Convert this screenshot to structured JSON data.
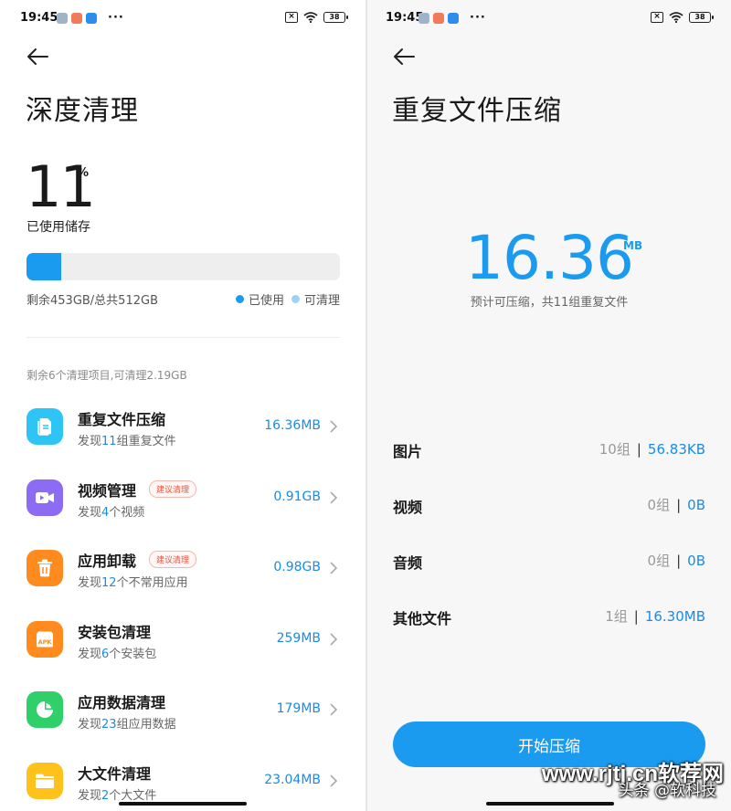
{
  "status_bar": {
    "time": "19:45",
    "battery": "38",
    "more": "···"
  },
  "left": {
    "title": "深度清理",
    "usage": {
      "percent": "11",
      "unit": "%",
      "label": "已使用储存",
      "fraction": 0.11
    },
    "storage_text": "剩余453GB/总共512GB",
    "legend": {
      "used": "已使用",
      "cleanable": "可清理"
    },
    "summary": "剩余6个清理项目,可清理2.19GB",
    "items": [
      {
        "title": "重复文件压缩",
        "tag": "",
        "desc_pre": "发现",
        "desc_num": "11",
        "desc_post": "组重复文件",
        "size": "16.36MB",
        "icon": "duplicate-file-icon",
        "color": "#2ec4f5"
      },
      {
        "title": "视频管理",
        "tag": "建议清理",
        "desc_pre": "发现",
        "desc_num": "4",
        "desc_post": "个视频",
        "size": "0.91GB",
        "icon": "video-icon",
        "color": "#8b6cf2"
      },
      {
        "title": "应用卸载",
        "tag": "建议清理",
        "desc_pre": "发现",
        "desc_num": "12",
        "desc_post": "个不常用应用",
        "size": "0.98GB",
        "icon": "trash-icon",
        "color": "#ff8a1e"
      },
      {
        "title": "安装包清理",
        "tag": "",
        "desc_pre": "发现",
        "desc_num": "6",
        "desc_post": "个安装包",
        "size": "259MB",
        "icon": "apk-icon",
        "color": "#ff8a1e"
      },
      {
        "title": "应用数据清理",
        "tag": "",
        "desc_pre": "发现",
        "desc_num": "23",
        "desc_post": "组应用数据",
        "size": "179MB",
        "icon": "pie-chart-icon",
        "color": "#2fcf6a"
      },
      {
        "title": "大文件清理",
        "tag": "",
        "desc_pre": "发现",
        "desc_num": "2",
        "desc_post": "个大文件",
        "size": "23.04MB",
        "icon": "folder-icon",
        "color": "#ffc21a"
      }
    ]
  },
  "right": {
    "title": "重复文件压缩",
    "value": "16.36",
    "unit": "MB",
    "caption": "预计可压缩，共11组重复文件",
    "categories": [
      {
        "name": "图片",
        "groups": "10组",
        "size": "56.83KB"
      },
      {
        "name": "视频",
        "groups": "0组",
        "size": "0B"
      },
      {
        "name": "音频",
        "groups": "0组",
        "size": "0B"
      },
      {
        "name": "其他文件",
        "groups": "1组",
        "size": "16.30MB"
      }
    ],
    "start_button": "开始压缩"
  },
  "watermark": {
    "main": "www.rjtj.cn软荐网",
    "sub": "头条 @软科技"
  },
  "colors": {
    "accent": "#1a9bf0",
    "link": "#1a8be8",
    "cleanable_dot": "#9ad3f7",
    "tag": "#e5533d"
  }
}
